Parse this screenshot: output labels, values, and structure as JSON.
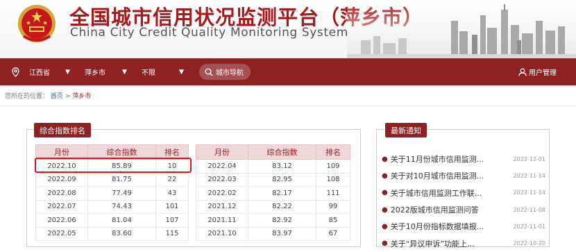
{
  "header": {
    "title_cn": "全国城市信用状况监测平台（萍乡市）",
    "title_en": "China City Credit Quality Monitoring System",
    "emblem_icon": "national-emblem-icon"
  },
  "nav": {
    "province": "江西省",
    "city": "萍乡市",
    "district": "不限",
    "search_label": "城市导航",
    "user_label": "用户管理"
  },
  "breadcrumb": {
    "prefix": "您所在的位置：",
    "home": "首页",
    "sep": ">",
    "current": "萍乡市"
  },
  "ranking": {
    "title": "综合指数排名",
    "headers": [
      "月份",
      "综合指数",
      "排名"
    ],
    "left_rows": [
      [
        "2022.10",
        "85.89",
        "10"
      ],
      [
        "2022.09",
        "81.75",
        "22"
      ],
      [
        "2022.08",
        "77.49",
        "43"
      ],
      [
        "2022.07",
        "74.43",
        "101"
      ],
      [
        "2022.06",
        "81.04",
        "107"
      ],
      [
        "2022.05",
        "83.60",
        "115"
      ]
    ],
    "right_rows": [
      [
        "2022.04",
        "83.12",
        "109"
      ],
      [
        "2022.03",
        "82.95",
        "108"
      ],
      [
        "2022.02",
        "82.17",
        "111"
      ],
      [
        "2021.12",
        "82.22",
        "99"
      ],
      [
        "2021.11",
        "82.92",
        "85"
      ],
      [
        "2021.10",
        "83.97",
        "67"
      ]
    ]
  },
  "notices": {
    "title": "最新通知",
    "items": [
      {
        "title": "关于11月份城市信用监测...",
        "date": "2022-12-01"
      },
      {
        "title": "关于对10月城市信用监测...",
        "date": "2022-11-14"
      },
      {
        "title": "关于城市信用监测工作联...",
        "date": "2022-11-14"
      },
      {
        "title": "2022版城市信用监测问答",
        "date": "2022-11-08"
      },
      {
        "title": "关于10月份指标数据填报...",
        "date": "2022-11-01"
      },
      {
        "title": "关于“异议申诉”功能上...",
        "date": "2022-10-20"
      }
    ]
  },
  "colors": {
    "brand_red": "#8e2121",
    "title_red": "#a8191b",
    "highlight_red": "#e0141c"
  }
}
